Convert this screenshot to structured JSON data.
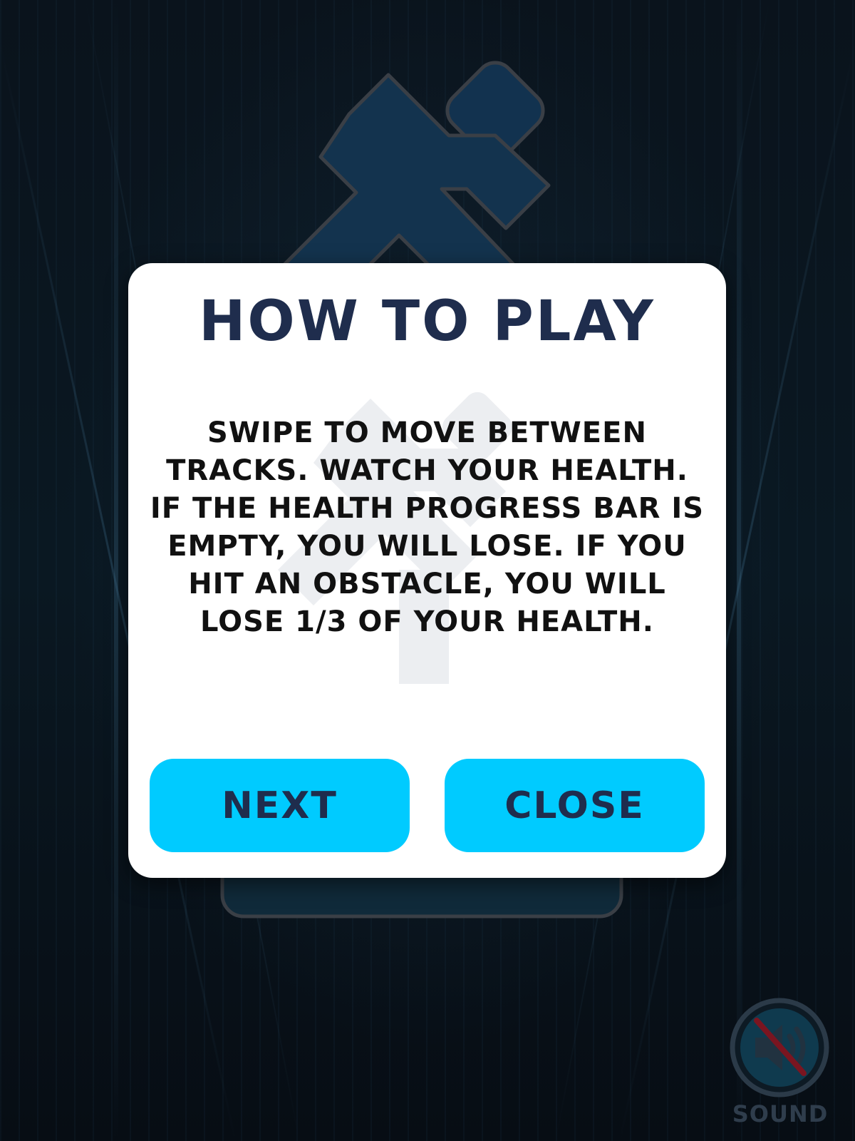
{
  "dialog": {
    "title": "HOW TO PLAY",
    "body": "SWIPE TO MOVE BETWEEN TRACKS. WATCH YOUR HEALTH. IF THE HEALTH PROGRESS BAR IS EMPTY, YOU WILL LOSE. IF YOU HIT AN OBSTACLE, YOU WILL LOSE 1/3 OF YOUR HEALTH.",
    "next_label": "NEXT",
    "close_label": "CLOSE"
  },
  "sound": {
    "label": "SOUND",
    "icon": "speaker-muted-icon",
    "muted": true
  },
  "background": {
    "logo_icon": "runner-icon"
  },
  "colors": {
    "dialog_bg": "#ffffff",
    "title": "#1f2d4d",
    "body_text": "#111111",
    "button_bg": "#00cbff",
    "button_text": "#1f2d4d",
    "mute_slash": "#7a1520"
  }
}
